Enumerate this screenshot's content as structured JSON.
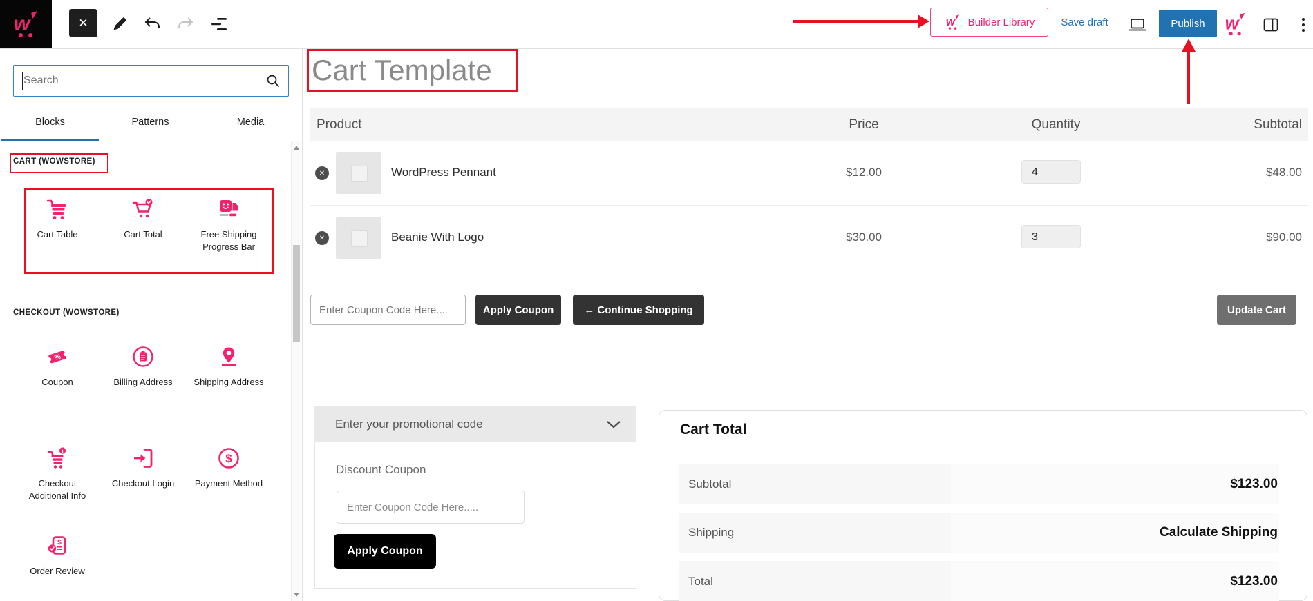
{
  "topbar": {
    "builder_library_label": "Builder Library",
    "save_draft_label": "Save draft",
    "publish_label": "Publish",
    "icons": [
      "wowstore-logo",
      "close",
      "edit-pencil",
      "undo",
      "redo",
      "list-view",
      "preview-desktop",
      "wowstore-logo",
      "settings-panel",
      "kebab-menu"
    ]
  },
  "sidebar": {
    "search_placeholder": "Search",
    "tabs": [
      {
        "label": "Blocks",
        "active": true
      },
      {
        "label": "Patterns",
        "active": false
      },
      {
        "label": "Media",
        "active": false
      }
    ],
    "sections": [
      {
        "title": "CART (WOWSTORE)",
        "items": [
          {
            "label": "Cart Table",
            "icon": "cart-table-icon"
          },
          {
            "label": "Cart Total",
            "icon": "cart-total-icon"
          },
          {
            "label": "Free Shipping Progress Bar",
            "icon": "free-shipping-progress-bar-icon"
          }
        ]
      },
      {
        "title": "CHECKOUT (WOWSTORE)",
        "items": [
          {
            "label": "Coupon",
            "icon": "coupon-icon"
          },
          {
            "label": "Billing Address",
            "icon": "billing-address-icon"
          },
          {
            "label": "Shipping Address",
            "icon": "shipping-address-icon"
          },
          {
            "label": "Checkout Additional Info",
            "icon": "checkout-additional-info-icon"
          },
          {
            "label": "Checkout Login",
            "icon": "checkout-login-icon"
          },
          {
            "label": "Payment Method",
            "icon": "payment-method-icon"
          },
          {
            "label": "Order Review",
            "icon": "order-review-icon"
          }
        ]
      }
    ]
  },
  "canvas": {
    "title": "Cart Template",
    "cart_table": {
      "headers": [
        "Product",
        "Price",
        "Quantity",
        "Subtotal"
      ],
      "rows": [
        {
          "name": "WordPress Pennant",
          "price": "$12.00",
          "quantity": "4",
          "subtotal": "$48.00"
        },
        {
          "name": "Beanie With Logo",
          "price": "$30.00",
          "quantity": "3",
          "subtotal": "$90.00"
        }
      ],
      "coupon_placeholder": "Enter Coupon Code Here....",
      "apply_coupon_label": "Apply Coupon",
      "continue_shopping_label": "← Continue Shopping",
      "update_cart_label": "Update Cart"
    },
    "promo": {
      "header": "Enter your promotional code",
      "discount_title": "Discount Coupon",
      "input_placeholder": "Enter Coupon Code Here.....",
      "apply_label": "Apply Coupon"
    },
    "cart_total": {
      "title": "Cart Total",
      "rows": [
        {
          "label": "Subtotal",
          "value": "$123.00"
        },
        {
          "label": "Shipping",
          "value": "Calculate Shipping"
        },
        {
          "label": "Total",
          "value": "$123.00"
        }
      ]
    }
  },
  "colors": {
    "brand_pink": "#f1236f",
    "wp_blue": "#2271b1",
    "annotation_red": "#e81123",
    "dark_button": "#333333",
    "black_button": "#000000",
    "muted_button": "#6f6f6f"
  }
}
